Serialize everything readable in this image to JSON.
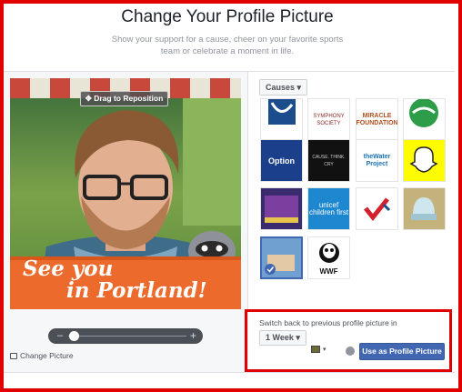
{
  "header": {
    "title": "Change Your Profile Picture",
    "subtitle": "Show your support for a cause, cheer on your favorite sports team or celebrate a moment in life."
  },
  "photo": {
    "drag_label": "Drag to Reposition",
    "banner_line1": "See you",
    "banner_line2": "in Portland!"
  },
  "zoom": {
    "minus": "–",
    "plus": "+",
    "level": 0.05
  },
  "change_picture": "Change Picture",
  "filters": {
    "category": "Causes",
    "tiles": [
      {
        "name": "tile-1",
        "text": "",
        "selected": false
      },
      {
        "name": "tile-symphony",
        "text": "SYMPHONY SOCIETY",
        "selected": false
      },
      {
        "name": "tile-miracle",
        "text": "MIRACLE FOUNDATION",
        "selected": false
      },
      {
        "name": "tile-green",
        "text": "",
        "selected": false
      },
      {
        "name": "tile-option",
        "text": "Option",
        "selected": false
      },
      {
        "name": "tile-black",
        "text": "CAUSE. THINK. CRY",
        "selected": false
      },
      {
        "name": "tile-water",
        "text": "theWater Project",
        "selected": false
      },
      {
        "name": "tile-snap",
        "text": "",
        "selected": false
      },
      {
        "name": "tile-purple",
        "text": "",
        "selected": false
      },
      {
        "name": "tile-unicef",
        "text": "unicef children first",
        "selected": false
      },
      {
        "name": "tile-check",
        "text": "",
        "selected": false
      },
      {
        "name": "tile-hat",
        "text": "",
        "selected": false
      },
      {
        "name": "tile-portland",
        "text": "",
        "selected": true
      },
      {
        "name": "tile-wwf",
        "text": "WWF",
        "selected": false
      }
    ]
  },
  "switch_back": {
    "label": "Switch back to previous profile picture in",
    "duration": "1 Week"
  },
  "use_button": "Use as Profile Picture",
  "colors": {
    "highlight": "#e00000",
    "primary_button": "#4267b2"
  }
}
